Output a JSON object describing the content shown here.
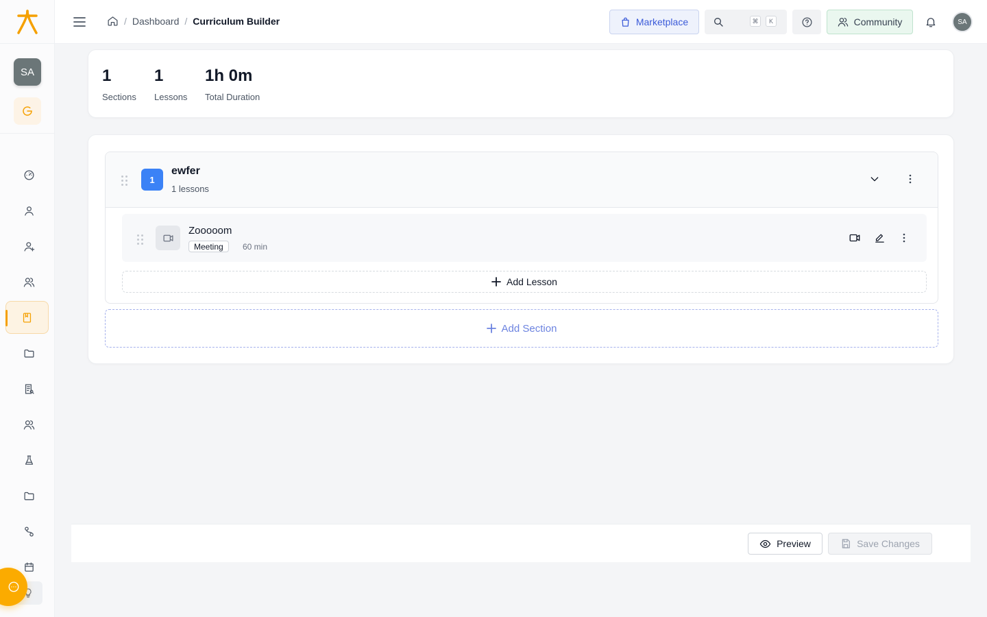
{
  "header": {
    "breadcrumb": {
      "dashboard": "Dashboard",
      "current": "Curriculum Builder",
      "separator": "/"
    },
    "marketplace_label": "Marketplace",
    "search_kbd": [
      "⌘",
      "K"
    ],
    "community_label": "Community",
    "user_initials": "SA"
  },
  "sidebar": {
    "user_initials": "SA",
    "items": [
      {
        "icon": "dashboard-gauge-icon"
      },
      {
        "icon": "user-icon"
      },
      {
        "icon": "user-add-icon"
      },
      {
        "icon": "users-icon"
      },
      {
        "icon": "book-icon",
        "active": true
      },
      {
        "icon": "folder-icon"
      },
      {
        "icon": "report-icon"
      },
      {
        "icon": "group-icon"
      },
      {
        "icon": "flask-icon"
      },
      {
        "icon": "folder-icon"
      },
      {
        "icon": "workflow-icon"
      },
      {
        "icon": "calendar-icon"
      }
    ],
    "accent_color": "#f5a000"
  },
  "stats": [
    {
      "value": "1",
      "label": "Sections"
    },
    {
      "value": "1",
      "label": "Lessons"
    },
    {
      "value": "1h 0m",
      "label": "Total Duration"
    }
  ],
  "curriculum": {
    "sections": [
      {
        "number": "1",
        "title": "ewfer",
        "subtitle": "1 lessons",
        "lessons": [
          {
            "title": "Zooooom",
            "type": "Meeting",
            "duration": "60 min"
          }
        ]
      }
    ],
    "add_lesson_label": "Add Lesson",
    "add_section_label": "Add Section"
  },
  "footer": {
    "preview_label": "Preview",
    "save_label": "Save Changes"
  },
  "colors": {
    "primary_blue": "#3b82f6",
    "accent_orange": "#fbab00",
    "link_blue": "#3b5bd9"
  }
}
